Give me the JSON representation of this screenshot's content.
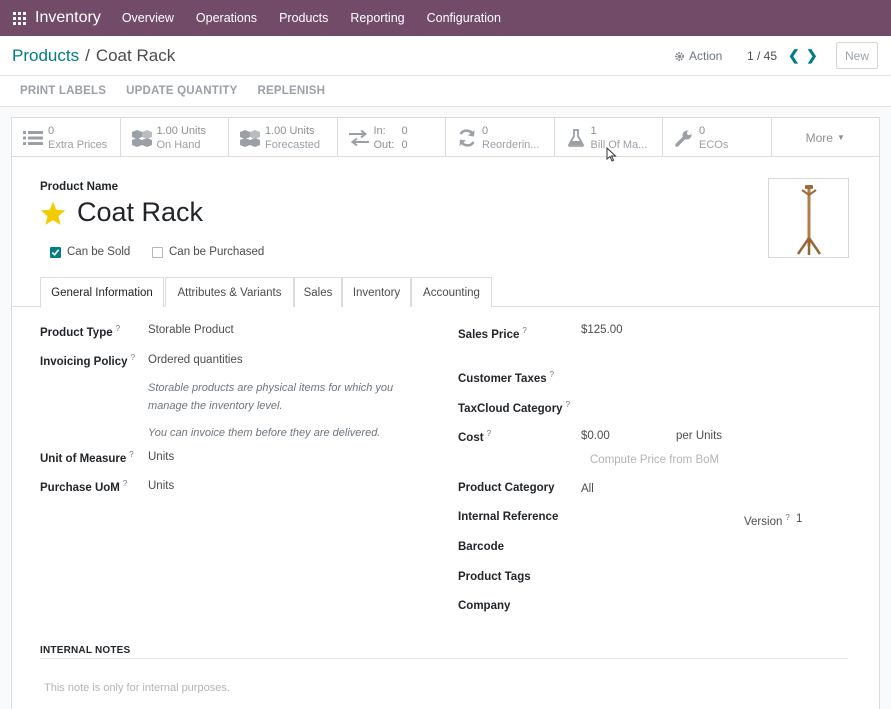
{
  "navbar": {
    "app_name": "Inventory",
    "menu": [
      "Overview",
      "Operations",
      "Products",
      "Reporting",
      "Configuration"
    ]
  },
  "control": {
    "breadcrumb_parent": "Products",
    "breadcrumb_separator": "/",
    "breadcrumb_current": "Coat Rack",
    "action_label": "Action",
    "pager": "1 / 45",
    "new_label": "New"
  },
  "status_buttons": [
    "PRINT LABELS",
    "UPDATE QUANTITY",
    "REPLENISH"
  ],
  "smart_buttons": [
    {
      "value": "0",
      "label": "Extra Prices",
      "icon": "list-icon"
    },
    {
      "value": "1.00 Units",
      "label": "On Hand",
      "icon": "cubes-icon"
    },
    {
      "value": "1.00 Units",
      "label": "Forecasted",
      "icon": "cubes-icon"
    },
    {
      "in_label": "In:",
      "in_value": "0",
      "out_label": "Out:",
      "out_value": "0",
      "icon": "exchange-icon"
    },
    {
      "value": "0",
      "label": "Reorderin...",
      "icon": "refresh-icon"
    },
    {
      "value": "1",
      "label": "Bill Of Ma...",
      "icon": "flask-icon"
    },
    {
      "value": "0",
      "label": "ECOs",
      "icon": "wrench-icon"
    },
    {
      "label": "More"
    }
  ],
  "product": {
    "name_label": "Product Name",
    "name": "Coat Rack",
    "can_be_sold": "Can be Sold",
    "can_be_purchased": "Can be Purchased"
  },
  "tabs": [
    "General Information",
    "Attributes & Variants",
    "Sales",
    "Inventory",
    "Accounting"
  ],
  "general": {
    "product_type_label": "Product Type",
    "product_type": "Storable Product",
    "invoicing_label": "Invoicing Policy",
    "invoicing": "Ordered quantities",
    "help_1a": "Storable products are physical items for which you",
    "help_1b": "manage the inventory level.",
    "help_2": "You can invoice them before they are delivered.",
    "uom_label": "Unit of Measure",
    "uom": "Units",
    "purchase_uom_label": "Purchase UoM",
    "purchase_uom": "Units",
    "sales_price_label": "Sales Price",
    "sales_price": "$125.00",
    "customer_taxes_label": "Customer Taxes",
    "taxcloud_label": "TaxCloud Category",
    "cost_label": "Cost",
    "cost": "$0.00",
    "cost_unit": "per Units",
    "compute_bom": "Compute Price from BoM",
    "category_label": "Product Category",
    "category": "All",
    "internal_ref_label": "Internal Reference",
    "version_label": "Version",
    "version": "1",
    "barcode_label": "Barcode",
    "tags_label": "Product Tags",
    "company_label": "Company",
    "help_mark": "?"
  },
  "notes": {
    "heading": "INTERNAL NOTES",
    "placeholder": "This note is only for internal purposes."
  },
  "colors": {
    "navbar": "#714b67",
    "accent": "#017e84",
    "star": "#f3cc00"
  }
}
